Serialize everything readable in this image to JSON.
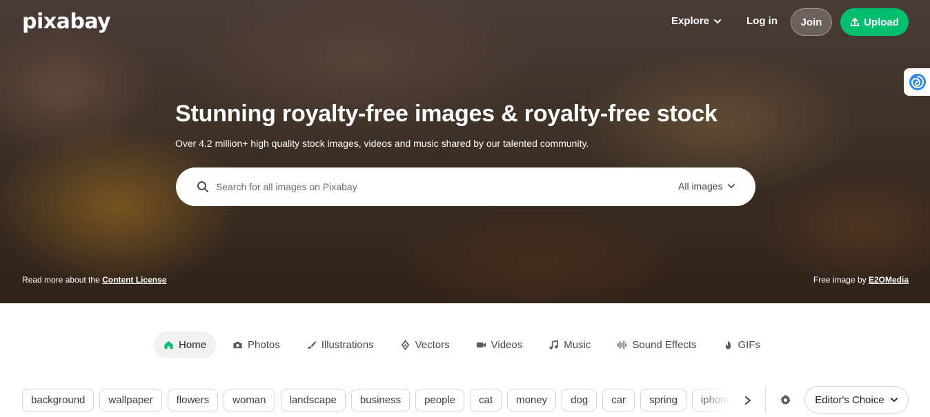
{
  "brand": {
    "logo_text": "pixabay",
    "accent": "#02be6e"
  },
  "nav": {
    "explore_label": "Explore",
    "login_label": "Log in",
    "join_label": "Join",
    "upload_label": "Upload"
  },
  "hero": {
    "title": "Stunning royalty-free images & royalty-free stock",
    "subtitle": "Over 4.2 million+ high quality stock images, videos and music shared by our talented community.",
    "license_prefix": "Read more about the ",
    "license_link": "Content License",
    "credit_prefix": "Free image by ",
    "credit_link": "E2OMedia"
  },
  "search": {
    "placeholder": "Search for all images on Pixabay",
    "filter_label": "All images"
  },
  "tabs": [
    {
      "label": "Home",
      "icon": "home-icon",
      "active": true
    },
    {
      "label": "Photos",
      "icon": "camera-icon"
    },
    {
      "label": "Illustrations",
      "icon": "brush-icon"
    },
    {
      "label": "Vectors",
      "icon": "pen-nib-icon"
    },
    {
      "label": "Videos",
      "icon": "video-camera-icon"
    },
    {
      "label": "Music",
      "icon": "music-note-icon"
    },
    {
      "label": "Sound Effects",
      "icon": "sound-wave-icon"
    },
    {
      "label": "GIFs",
      "icon": "flame-icon"
    }
  ],
  "tags": [
    "background",
    "wallpaper",
    "flowers",
    "woman",
    "landscape",
    "business",
    "people",
    "cat",
    "money",
    "dog",
    "car",
    "spring",
    "iphone"
  ],
  "sort": {
    "label": "Editor's Choice"
  }
}
